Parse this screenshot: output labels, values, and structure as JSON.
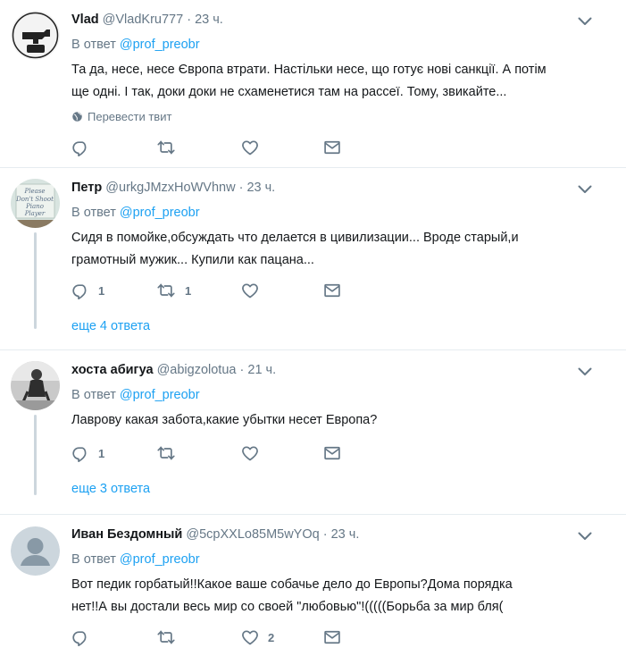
{
  "tweets": [
    {
      "name": "Vlad",
      "handle": "@VladKru777",
      "dot": "·",
      "time": "23 ч.",
      "reply_prefix": "В ответ",
      "reply_to": "@prof_preobr",
      "text_line1": "Та да, несе, несе Європа втрати. Настільки несе, що готує нові санкції. А потім",
      "text_line2": "ще одні. І так, доки доки не схаменетися там на рассеї. Тому, звикайте...",
      "translate_label": "Перевести твит",
      "replies": "",
      "retweets": "",
      "likes": "",
      "avatar_text_top": "I DON'T DIAL",
      "avatar_text_bottom": "911"
    },
    {
      "name": "Петр",
      "handle": "@urkgJMzxHoWVhnw",
      "dot": "·",
      "time": "23 ч.",
      "reply_prefix": "В ответ",
      "reply_to": "@prof_preobr",
      "text_line1": "Сидя в помойке,обсуждать что делается в цивилизации... Вроде старый,и",
      "text_line2": "грамотный мужик... Купили как пацана...",
      "replies": "1",
      "retweets": "1",
      "likes": "",
      "more_label": "еще 4 ответа",
      "avatar_text": "Please Don't Shoot The Piano Player"
    },
    {
      "name": "хоста абигуа",
      "handle": "@abigzolotua",
      "dot": "·",
      "time": "21 ч.",
      "reply_prefix": "В ответ",
      "reply_to": "@prof_preobr",
      "text_line1": "Лаврову какая забота,какие убытки несет Европа?",
      "replies": "1",
      "retweets": "",
      "likes": "",
      "more_label": "еще 3 ответа"
    },
    {
      "name": "Иван Бездомный",
      "handle": "@5cpXXLo85M5wYOq",
      "dot": "·",
      "time": "23 ч.",
      "reply_prefix": "В ответ",
      "reply_to": "@prof_preobr",
      "text_line1": "Вот педик горбатый!!Какое ваше собачье дело до Европы?Дома порядка",
      "text_line2": "нет!!А вы достали весь мир со своей \"любовью\"!(((((Борьба за мир бля(",
      "replies": "",
      "retweets": "",
      "likes": "2"
    }
  ],
  "colors": {
    "link": "#1da1f2",
    "muted": "#657786",
    "text": "#14171a",
    "divider": "#e6ecf0",
    "thread": "#ccd6dd"
  }
}
